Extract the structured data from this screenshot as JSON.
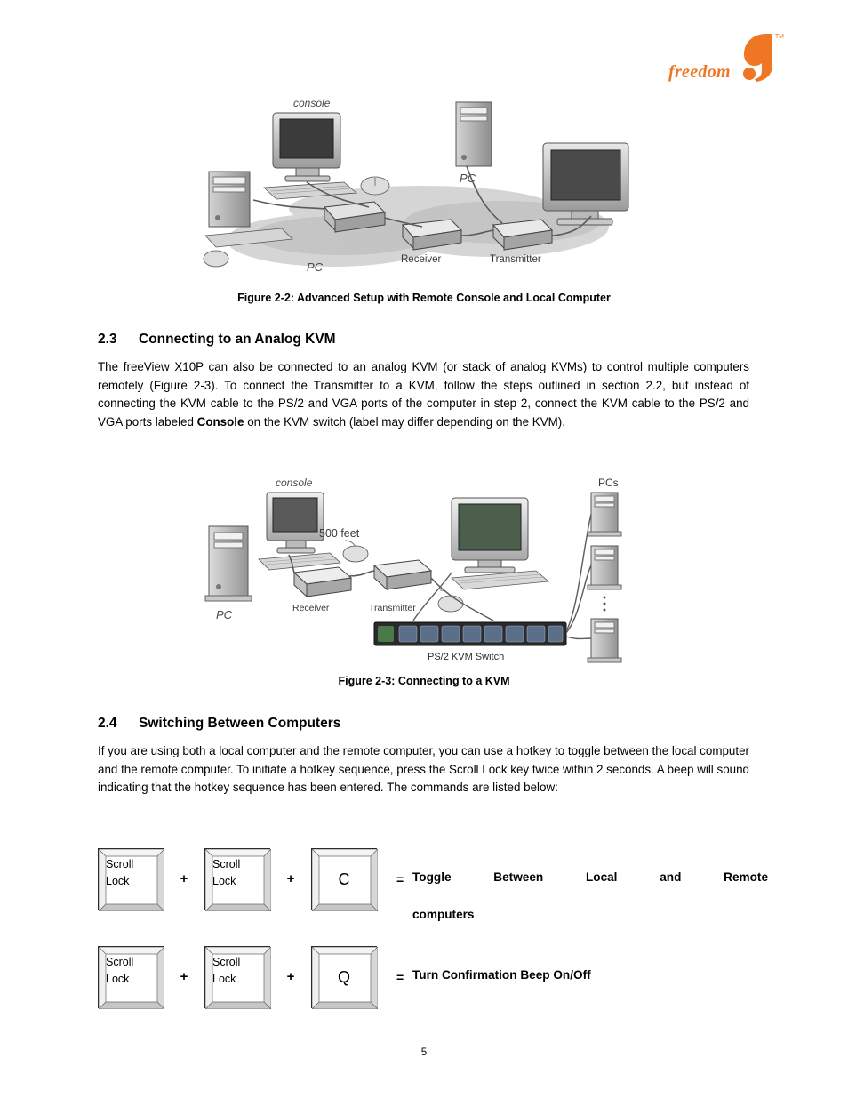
{
  "logo": {
    "wordmark": "freedom",
    "trademark": "TM",
    "color": "#ef7622"
  },
  "figures": {
    "fig22": {
      "caption": "Figure 2-2: Advanced Setup with Remote Console and Local Computer",
      "labels": {
        "console": "console",
        "pc_right": "PC",
        "pc_left": "PC",
        "receiver": "Receiver",
        "transmitter": "Transmitter"
      }
    },
    "fig23": {
      "caption": "Figure 2-3: Connecting to a KVM",
      "labels": {
        "console": "console",
        "pcs": "PCs",
        "distance": "500 feet",
        "pc": "PC",
        "receiver": "Receiver",
        "transmitter": "Transmitter",
        "switch": "PS/2 KVM Switch"
      }
    }
  },
  "sections": [
    {
      "number": "2.3",
      "title": "Connecting to an Analog KVM",
      "paragraph_parts": [
        {
          "text": "The  freeView  X10P  can  also  be  connected  to  an  analog  KVM  (or  stack  of  analog  KVMs)  to control multiple computers remotely (Figure 2-3).  To connect the Transmitter to a KVM, follow the steps outlined in section 2.2, but instead of connecting the KVM cable to the PS/2 and VGA ports  of  the  computer  in  step  2,  connect  the  KVM  cable  to  the  PS/2  and  VGA  ports  labeled ",
          "bold": false
        },
        {
          "text": "Console",
          "bold": true
        },
        {
          "text": " on the KVM switch (label may differ depending on the KVM).",
          "bold": false
        }
      ]
    },
    {
      "number": "2.4",
      "title": "Switching Between Computers",
      "paragraph_parts": [
        {
          "text": "If you are using both a local computer and the remote computer, you can use a hotkey to toggle between the local computer and the remote computer.  To initiate a hotkey sequence, press the Scroll Lock key twice within 2 seconds.  A beep will sound indicating that the hotkey sequence has been entered.  The commands are listed below:",
          "bold": false
        }
      ]
    }
  ],
  "hotkeys": [
    {
      "key1_line1": "Scroll",
      "key1_line2": "Lock",
      "plus1": "+",
      "key2_line1": "Scroll",
      "key2_line2": "Lock",
      "plus2": "+",
      "key3": "C",
      "equals": "=",
      "description_line1": "Toggle    Between    Local    and    Remote",
      "description_line2": "computers"
    },
    {
      "key1_line1": "Scroll",
      "key1_line2": "Lock",
      "plus1": "+",
      "key2_line1": "Scroll",
      "key2_line2": "Lock",
      "plus2": "+",
      "key3": "Q",
      "equals": "=",
      "description_line1": "Turn Confirmation Beep On/Off",
      "description_line2": ""
    }
  ],
  "footer": {
    "page_number": "5"
  }
}
